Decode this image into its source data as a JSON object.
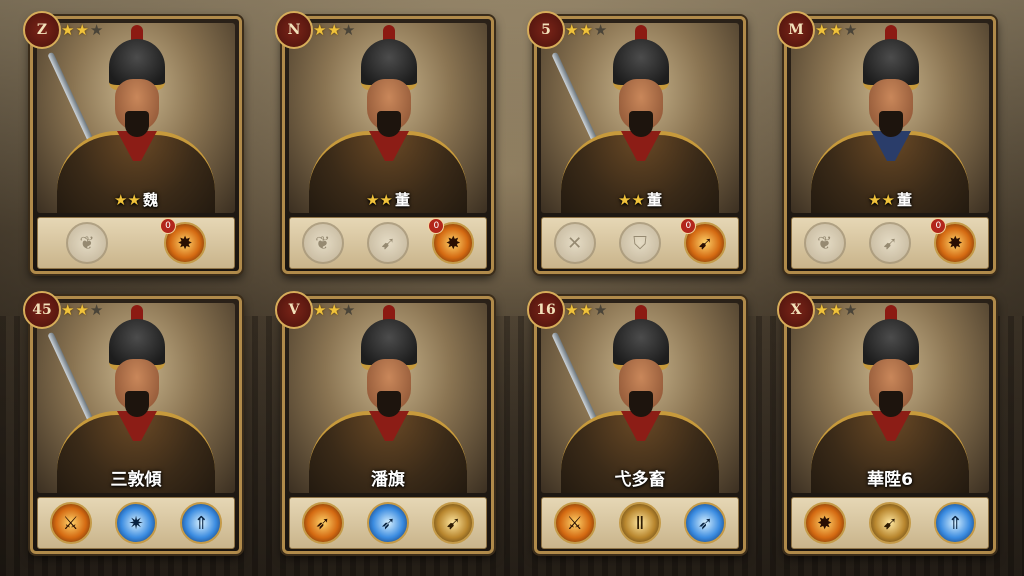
{
  "cards": [
    {
      "badge": "Z",
      "card_stars": 2,
      "name_stars": "★★",
      "name": "魏",
      "skills": [
        {
          "icon": "leaf-emblem-icon",
          "glyph": "❦",
          "style": "locked"
        },
        {
          "icon": "flame-slash-icon",
          "glyph": "✸",
          "style": "fire",
          "tag": "0"
        }
      ]
    },
    {
      "badge": "N",
      "card_stars": 2,
      "name_stars": "★★",
      "name": "董",
      "skills": [
        {
          "icon": "leaf-emblem-icon",
          "glyph": "❦",
          "style": "locked"
        },
        {
          "icon": "arrow-strike-icon",
          "glyph": "➹",
          "style": "locked"
        },
        {
          "icon": "flame-slash-icon",
          "glyph": "✸",
          "style": "fire",
          "tag": "0"
        }
      ]
    },
    {
      "badge": "5",
      "card_stars": 2,
      "name_stars": "★★",
      "name": "董",
      "skills": [
        {
          "icon": "crossed-blades-icon",
          "glyph": "✕",
          "style": "locked"
        },
        {
          "icon": "helmet-emblem-icon",
          "glyph": "⛉",
          "style": "locked"
        },
        {
          "icon": "arrow-strike-icon",
          "glyph": "➹",
          "style": "fire",
          "tag": "0"
        }
      ]
    },
    {
      "badge": "M",
      "card_stars": 2,
      "name_stars": "★★",
      "name": "董",
      "skills": [
        {
          "icon": "leaf-emblem-icon",
          "glyph": "❦",
          "style": "locked"
        },
        {
          "icon": "arrow-strike-icon",
          "glyph": "➹",
          "style": "locked"
        },
        {
          "icon": "flame-slash-icon",
          "glyph": "✸",
          "style": "fire",
          "tag": "0"
        }
      ]
    },
    {
      "badge": "45",
      "card_stars": 2,
      "name": "三敦傾",
      "skills": [
        {
          "icon": "sword-slash-icon",
          "glyph": "⚔",
          "style": "fire"
        },
        {
          "icon": "ice-burst-icon",
          "glyph": "✷",
          "style": "ice"
        },
        {
          "icon": "spear-icon",
          "glyph": "⇑",
          "style": "ice"
        }
      ]
    },
    {
      "badge": "V",
      "card_stars": 2,
      "name": "潘旗",
      "skills": [
        {
          "icon": "spear-strike-icon",
          "glyph": "➶",
          "style": "fire"
        },
        {
          "icon": "ice-spear-icon",
          "glyph": "➶",
          "style": "ice"
        },
        {
          "icon": "arrow-strike-icon",
          "glyph": "➹",
          "style": "gold"
        }
      ]
    },
    {
      "badge": "16",
      "card_stars": 2,
      "name": "弋多畜",
      "skills": [
        {
          "icon": "sword-slash-icon",
          "glyph": "⚔",
          "style": "fire"
        },
        {
          "icon": "gate-emblem-icon",
          "glyph": "Ⅱ",
          "style": "gold"
        },
        {
          "icon": "ice-spear-icon",
          "glyph": "➶",
          "style": "ice"
        }
      ]
    },
    {
      "badge": "X",
      "card_stars": 2,
      "name": "華陞6",
      "skills": [
        {
          "icon": "flame-burst-icon",
          "glyph": "✸",
          "style": "fire"
        },
        {
          "icon": "arrow-strike-icon",
          "glyph": "➹",
          "style": "gold"
        },
        {
          "icon": "spear-icon",
          "glyph": "⇑",
          "style": "ice"
        }
      ]
    }
  ]
}
